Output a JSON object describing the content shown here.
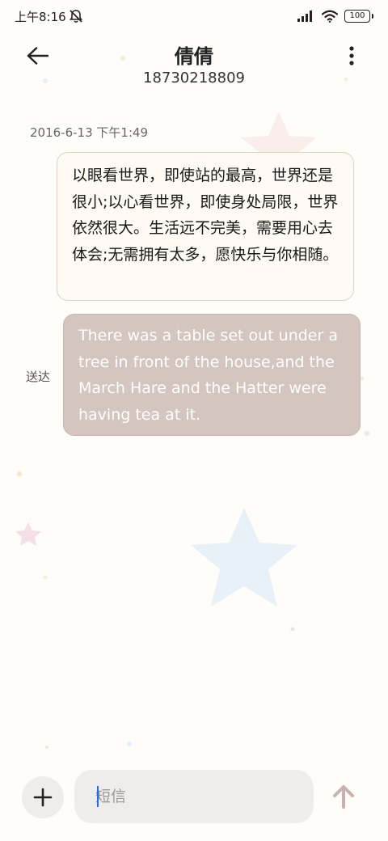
{
  "status_bar": {
    "time": "上午8:16",
    "battery": "100",
    "icons": [
      "mute-icon",
      "signal-icon",
      "wifi-icon",
      "battery-icon"
    ]
  },
  "header": {
    "contact_name": "倩倩",
    "contact_number": "18730218809",
    "back_icon": "back-arrow-icon",
    "menu_icon": "more-vert-icon"
  },
  "conversation": {
    "timestamp": "2016-6-13 下午1:49",
    "messages": [
      {
        "direction": "incoming",
        "text": "以眼看世界，即使站的最高，世界还是很小;以心看世界，即使身处局限，世界依然很大。生活远不完美，需要用心去体会;无需拥有太多，愿快乐与你相随。"
      },
      {
        "direction": "outgoing",
        "text": "There was a table set out under a tree in front of the house,and the March Hare and the Hatter were having tea at it.",
        "status": "送达"
      }
    ]
  },
  "composer": {
    "add_icon": "plus-icon",
    "placeholder": "短信",
    "value": "",
    "send_icon": "send-arrow-icon"
  },
  "colors": {
    "background": "#fefdf9",
    "incoming_bubble": "#fffaf4",
    "outgoing_bubble": "#d5c5bf",
    "caret": "#2b6de0",
    "send_icon": "#c9b1ad"
  }
}
